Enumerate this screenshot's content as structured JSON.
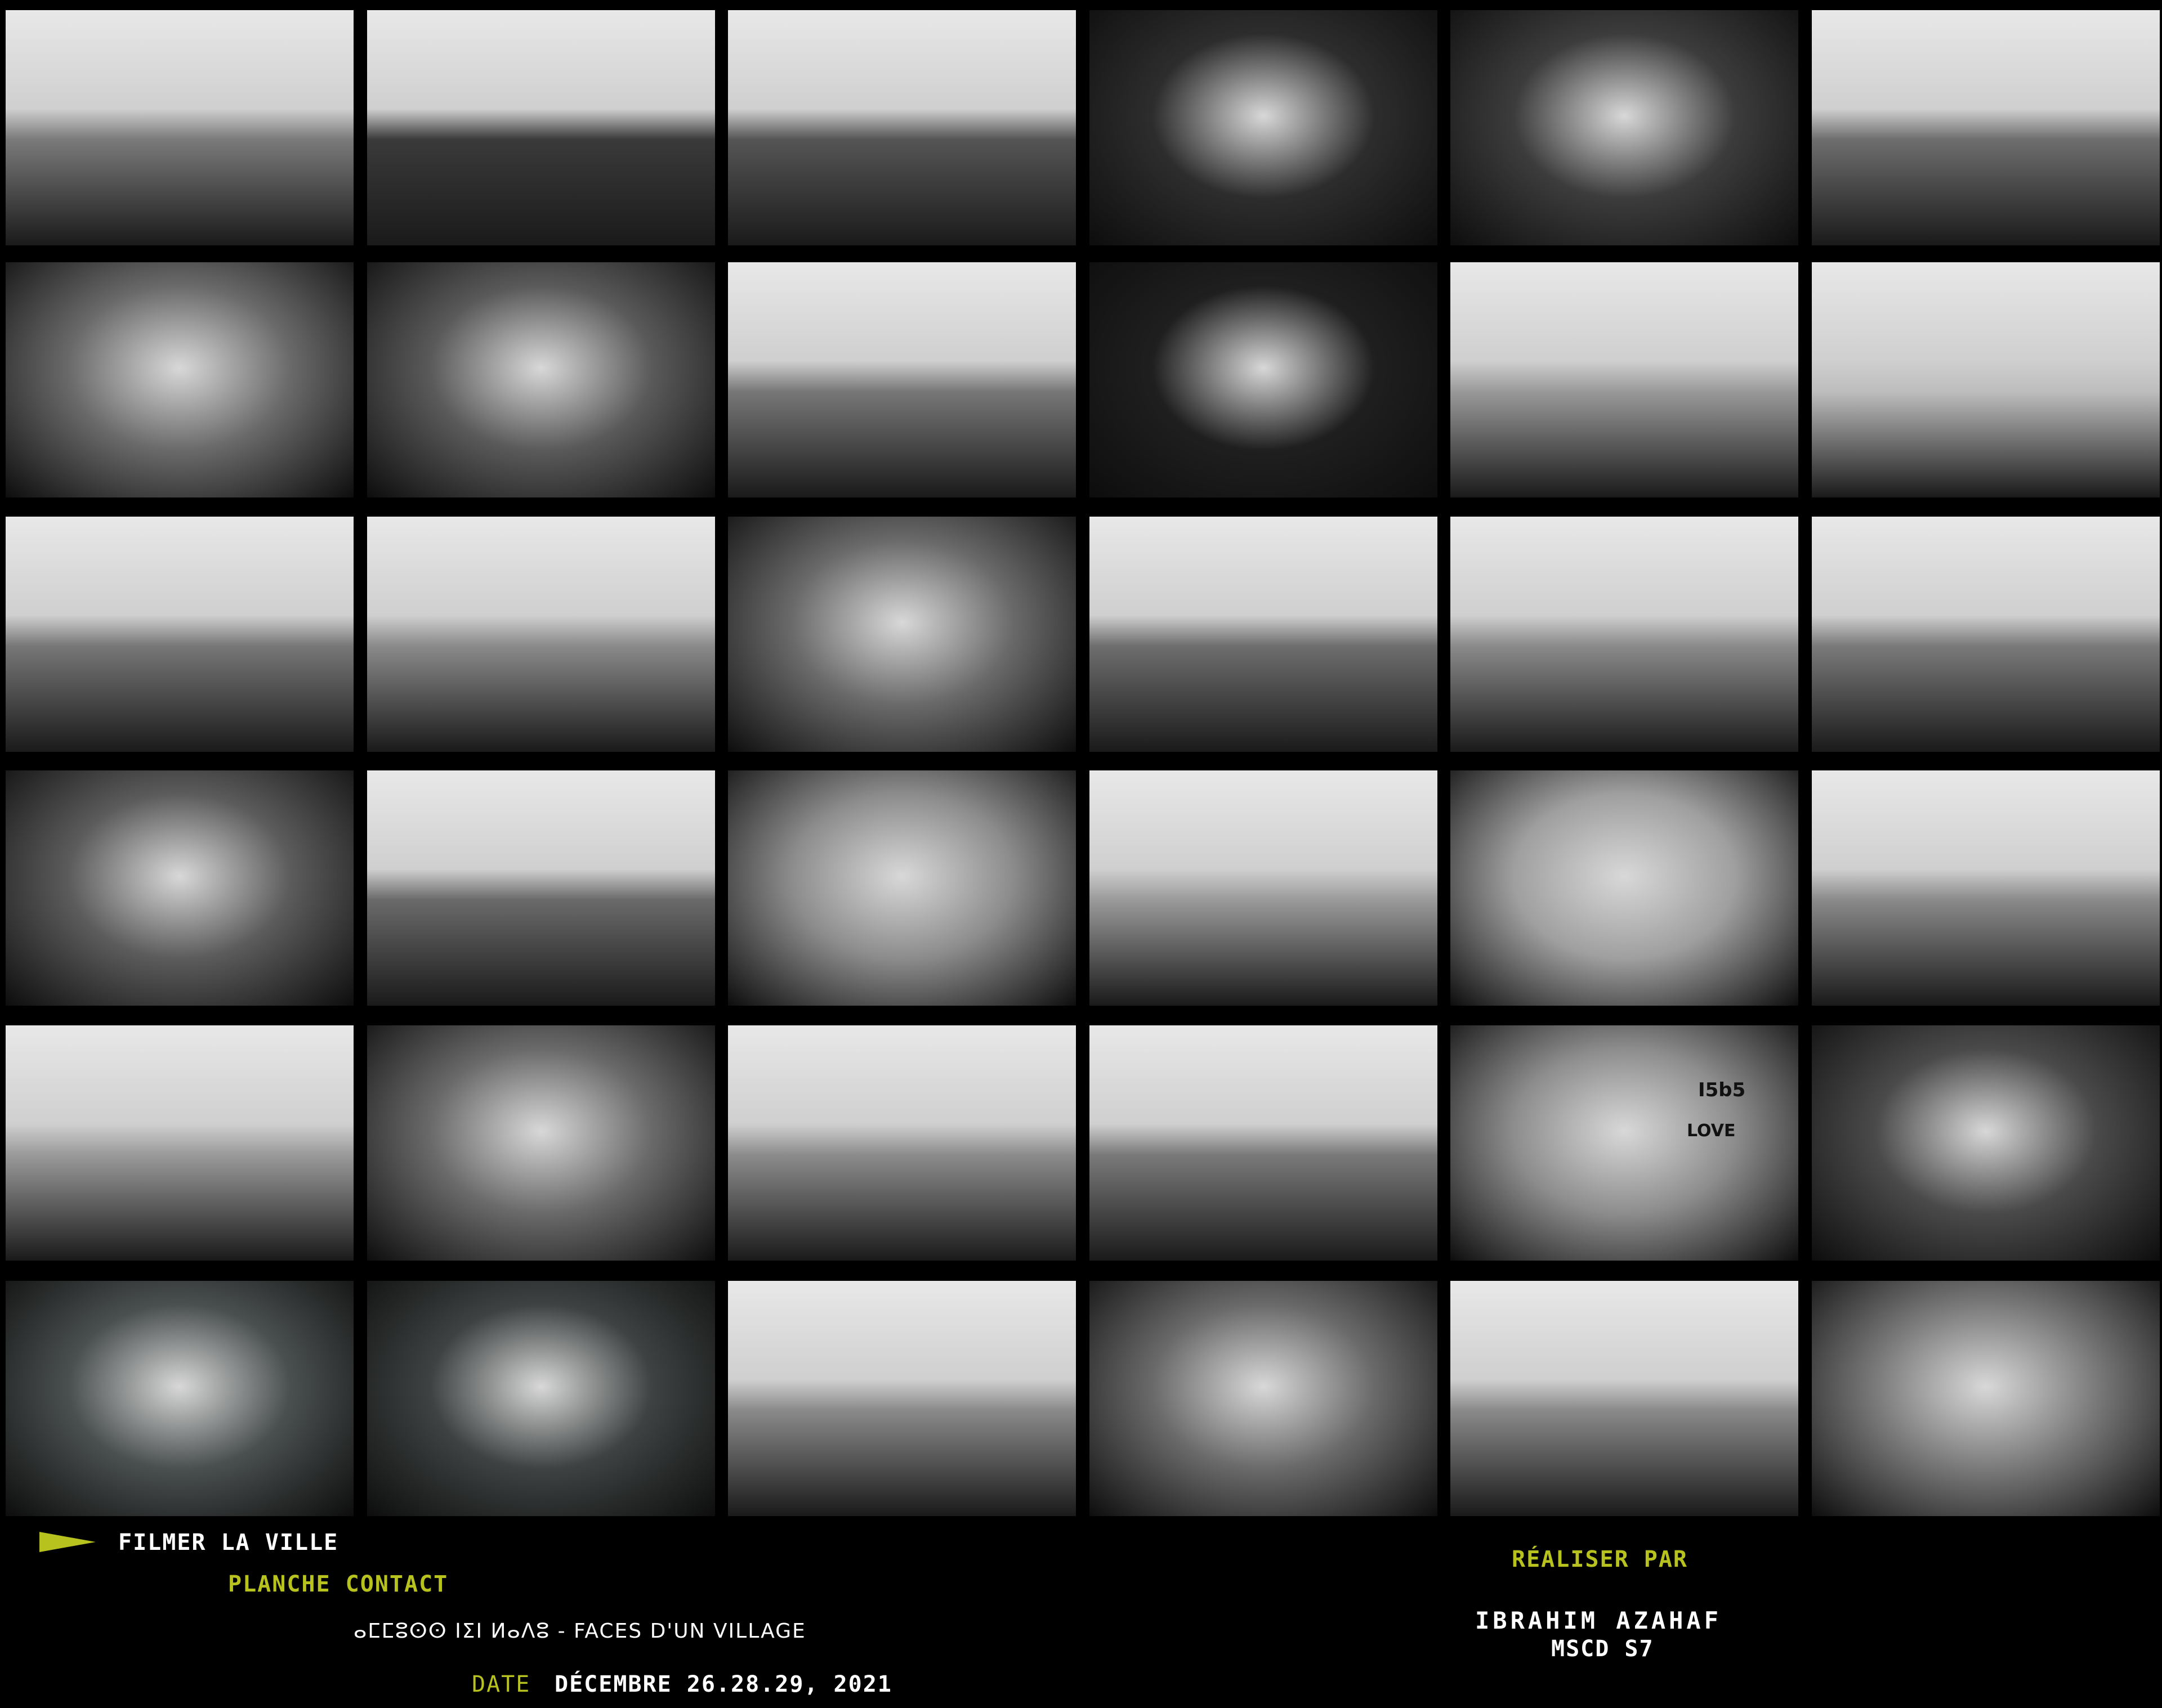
{
  "sheet": {
    "photo_count": 36,
    "rows": 6,
    "columns": 6,
    "style": "black-and-white film contact sheet"
  },
  "captions": {
    "series_title": "FILMER LA VILLE",
    "subtitle": "PLANCHE CONTACT",
    "project_title": "ⴰⵎⵎⵓⵙⵙ ⵏⵉⵏ ⵍⴰⴷⵓ - FACES D'UN VILLAGE",
    "date_label": "DATE",
    "date_value": "DÉCEMBRE 26.28.29, 2021",
    "credit_label": "RÉALISER PAR",
    "author": "IBRAHIM AZAHAF",
    "program": "MSCD S7"
  },
  "photo_text": {
    "graffiti_love": "LOVE",
    "graffiti_code": "I5b5"
  },
  "colors": {
    "background": "#000000",
    "accent": "#b7c21f",
    "text": "#ffffff"
  }
}
